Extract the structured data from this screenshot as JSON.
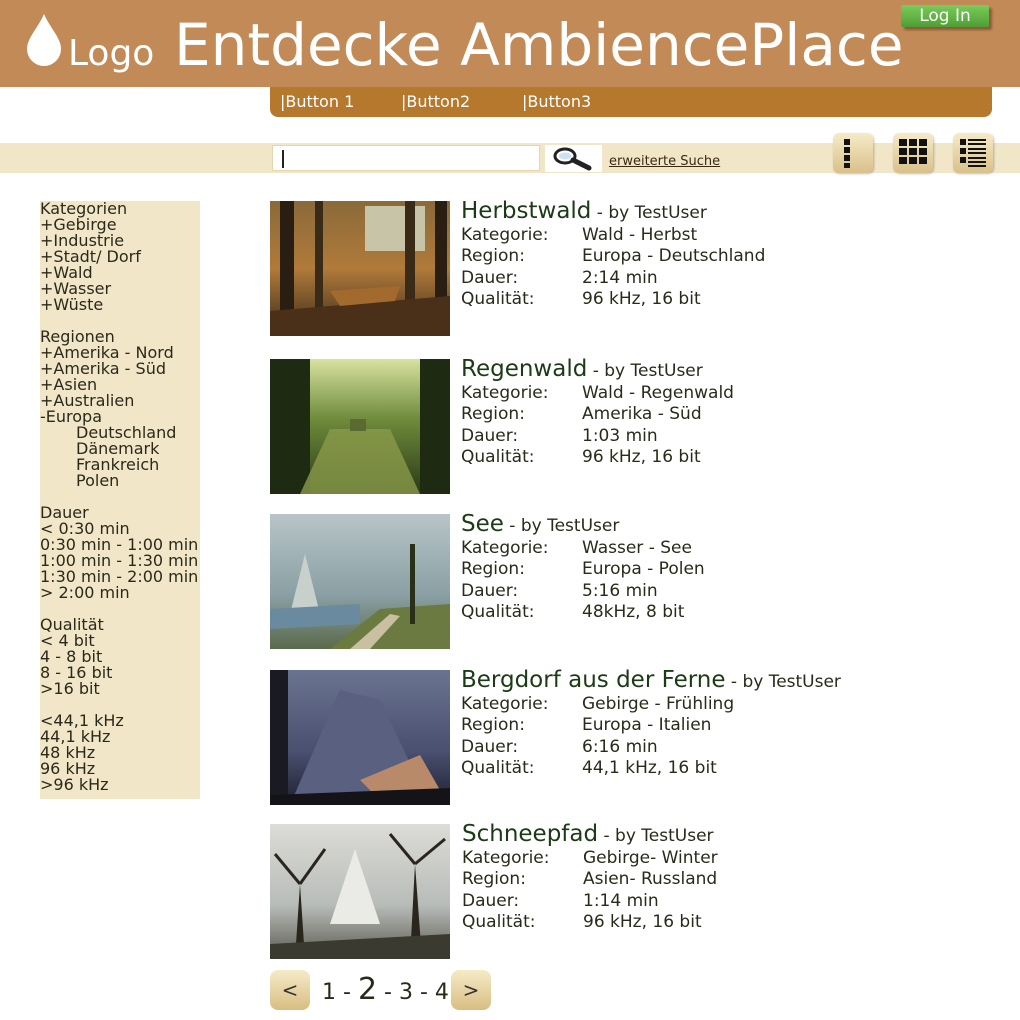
{
  "header": {
    "logo": "Logo",
    "title": "Entdecke AmbiencePlace",
    "login": "Log In"
  },
  "nav": [
    "|Button 1",
    "|Button2",
    "|Button3"
  ],
  "search": {
    "value": "",
    "advanced": "erweiterte Suche"
  },
  "view_icons": [
    "list-narrow-icon",
    "grid-icon",
    "list-detail-icon"
  ],
  "sidebar": {
    "kategorien": {
      "title": "Kategorien",
      "items": [
        "+Gebirge",
        "+Industrie",
        "+Stadt/ Dorf",
        "+Wald",
        "+Wasser",
        "+Wüste"
      ]
    },
    "regionen": {
      "title": "Regionen",
      "items": [
        "+Amerika - Nord",
        "+Amerika - Süd",
        "+Asien",
        "+Australien",
        "-Europa"
      ],
      "sub": [
        "Deutschland",
        "Dänemark",
        "Frankreich",
        "Polen"
      ]
    },
    "dauer": {
      "title": "Dauer",
      "items": [
        "< 0:30 min",
        "0:30 min - 1:00 min",
        "1:00 min - 1:30 min",
        "1:30 min - 2:00 min",
        "> 2:00 min"
      ]
    },
    "qualitaet": {
      "title": "Qualität",
      "bits": [
        "< 4 bit",
        "4 - 8 bit",
        "8 - 16 bit",
        ">16 bit"
      ],
      "khz": [
        "<44,1 kHz",
        "44,1 kHz",
        "48 kHz",
        "96 kHz",
        ">96 kHz"
      ]
    }
  },
  "labels": {
    "kategorie": "Kategorie:",
    "region": "Region:",
    "dauer": "Dauer:",
    "qualitaet": "Qualität:"
  },
  "results": [
    {
      "title": "Herbstwald",
      "by": " - by TestUser",
      "kategorie": "Wald - Herbst",
      "region": "Europa - Deutschland",
      "dauer": "2:14 min",
      "qualitaet": "96 kHz, 16 bit"
    },
    {
      "title": "Regenwald",
      "by": " - by TestUser",
      "kategorie": "Wald - Regenwald",
      "region": "Amerika - Süd",
      "dauer": "1:03 min",
      "qualitaet": "96 kHz, 16 bit"
    },
    {
      "title": "See",
      "by": " - by TestUser",
      "kategorie": "Wasser - See",
      "region": "Europa - Polen",
      "dauer": "5:16 min",
      "qualitaet": "48kHz, 8 bit"
    },
    {
      "title": "Bergdorf aus der Ferne",
      "by": " - by TestUser",
      "kategorie": "Gebirge - Frühling",
      "region": "Europa - Italien",
      "dauer": "6:16 min",
      "qualitaet": "44,1 kHz, 16 bit"
    },
    {
      "title": "Schneepfad",
      "by": " - by TestUser",
      "kategorie": "Gebirge- Winter",
      "region": "Asien- Russland",
      "dauer": "1:14 min",
      "qualitaet": "96 kHz, 16 bit"
    }
  ],
  "pager": {
    "prev": "<",
    "next": ">",
    "p1": "1",
    "sep1": " - ",
    "p2": "2",
    "sep2": " - ",
    "p3": "3",
    "sep3": " - ",
    "p4": "4"
  }
}
